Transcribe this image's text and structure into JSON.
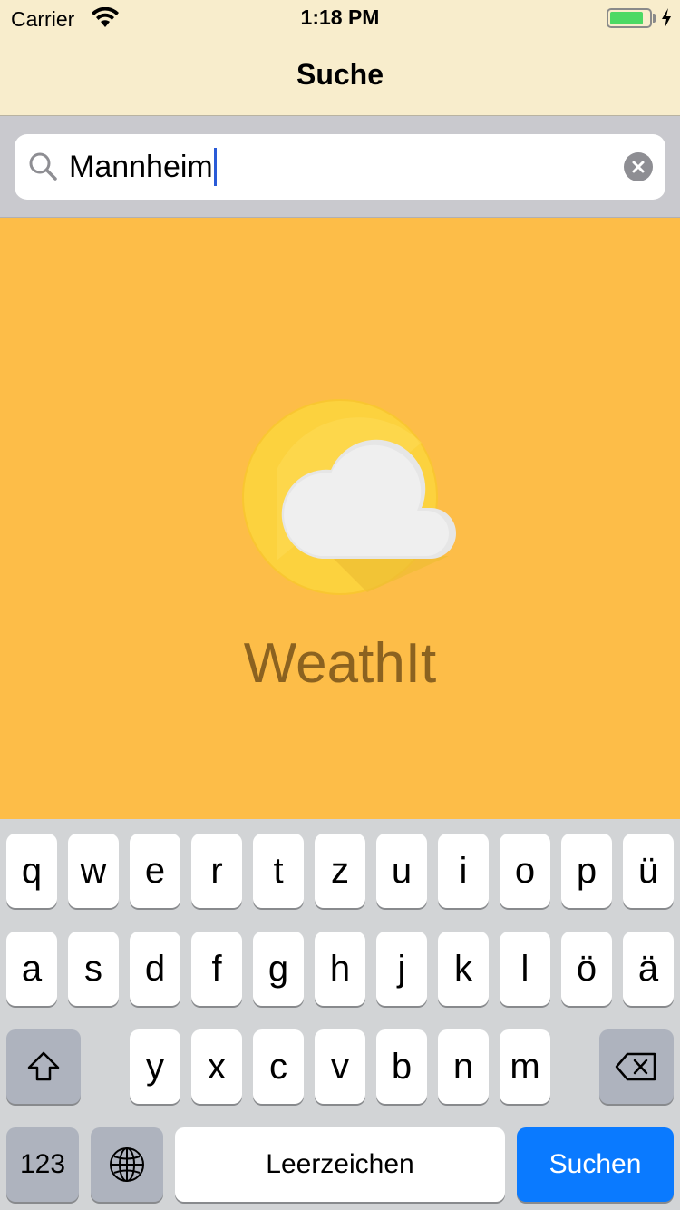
{
  "status_bar": {
    "carrier": "Carrier",
    "time": "1:18 PM",
    "battery_level": 0.85,
    "battery_color": "#4cd964"
  },
  "nav": {
    "title": "Suche"
  },
  "search": {
    "value": "Mannheim",
    "search_icon": "search-icon",
    "clear_icon": "clear-icon"
  },
  "splash": {
    "app_name": "WeathIt",
    "logo_icon": "sun-cloud-icon"
  },
  "keyboard": {
    "row1": [
      "q",
      "w",
      "e",
      "r",
      "t",
      "z",
      "u",
      "i",
      "o",
      "p",
      "ü"
    ],
    "row2": [
      "a",
      "s",
      "d",
      "f",
      "g",
      "h",
      "j",
      "k",
      "l",
      "ö",
      "ä"
    ],
    "row3": [
      "y",
      "x",
      "c",
      "v",
      "b",
      "n",
      "m"
    ],
    "numbers_label": "123",
    "space_label": "Leerzeichen",
    "return_label": "Suchen",
    "shift_icon": "shift-icon",
    "globe_icon": "globe-icon",
    "delete_icon": "delete-icon"
  },
  "colors": {
    "background": "#fdbd48",
    "nav_background": "#f8edcc",
    "accent": "#0a7aff",
    "app_name": "#8b6220"
  }
}
